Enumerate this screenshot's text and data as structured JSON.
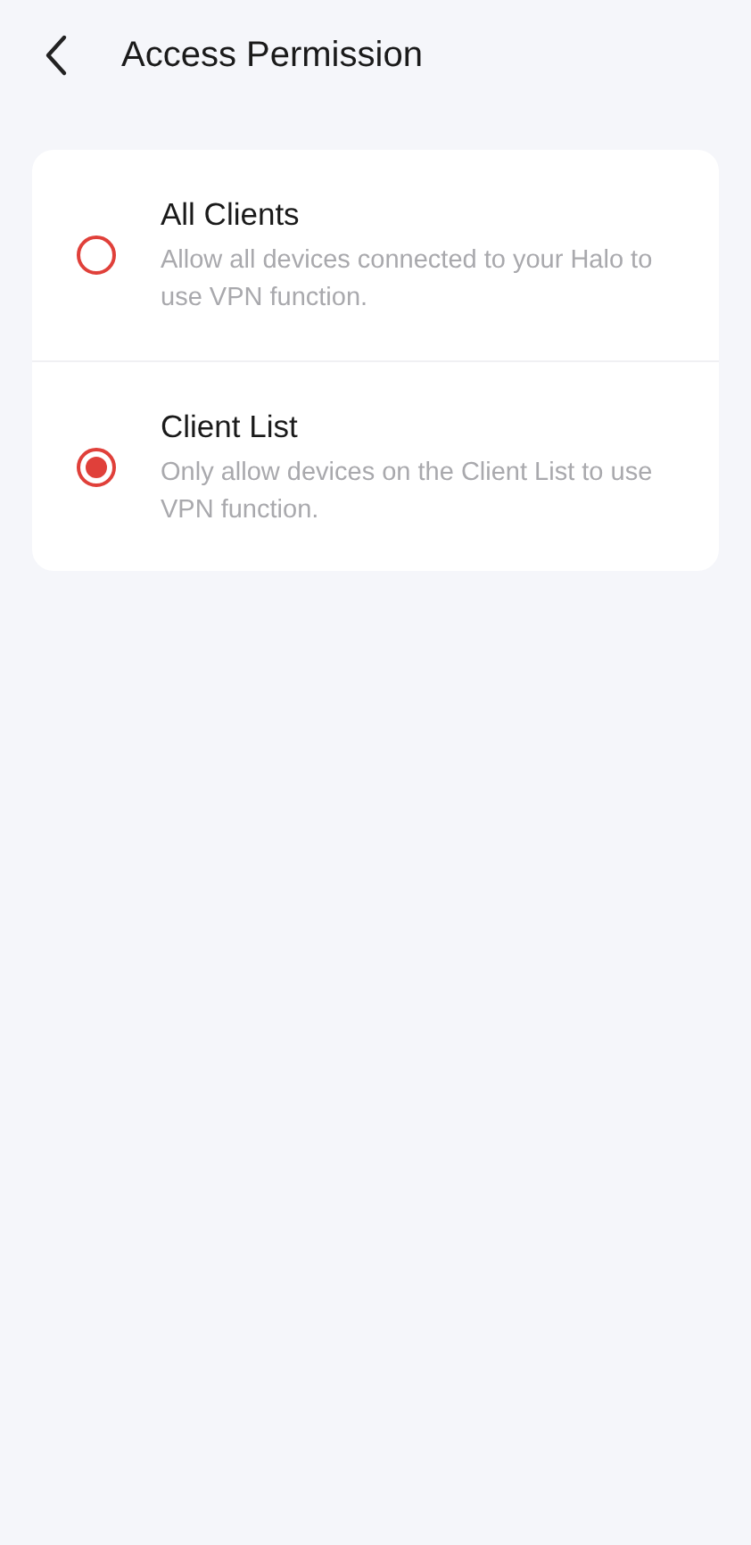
{
  "header": {
    "title": "Access Permission"
  },
  "options": [
    {
      "title": "All Clients",
      "description": "Allow all devices connected to your Halo to use VPN function.",
      "selected": false
    },
    {
      "title": "Client List",
      "description": "Only allow devices on the Client List to use VPN function.",
      "selected": true
    }
  ]
}
